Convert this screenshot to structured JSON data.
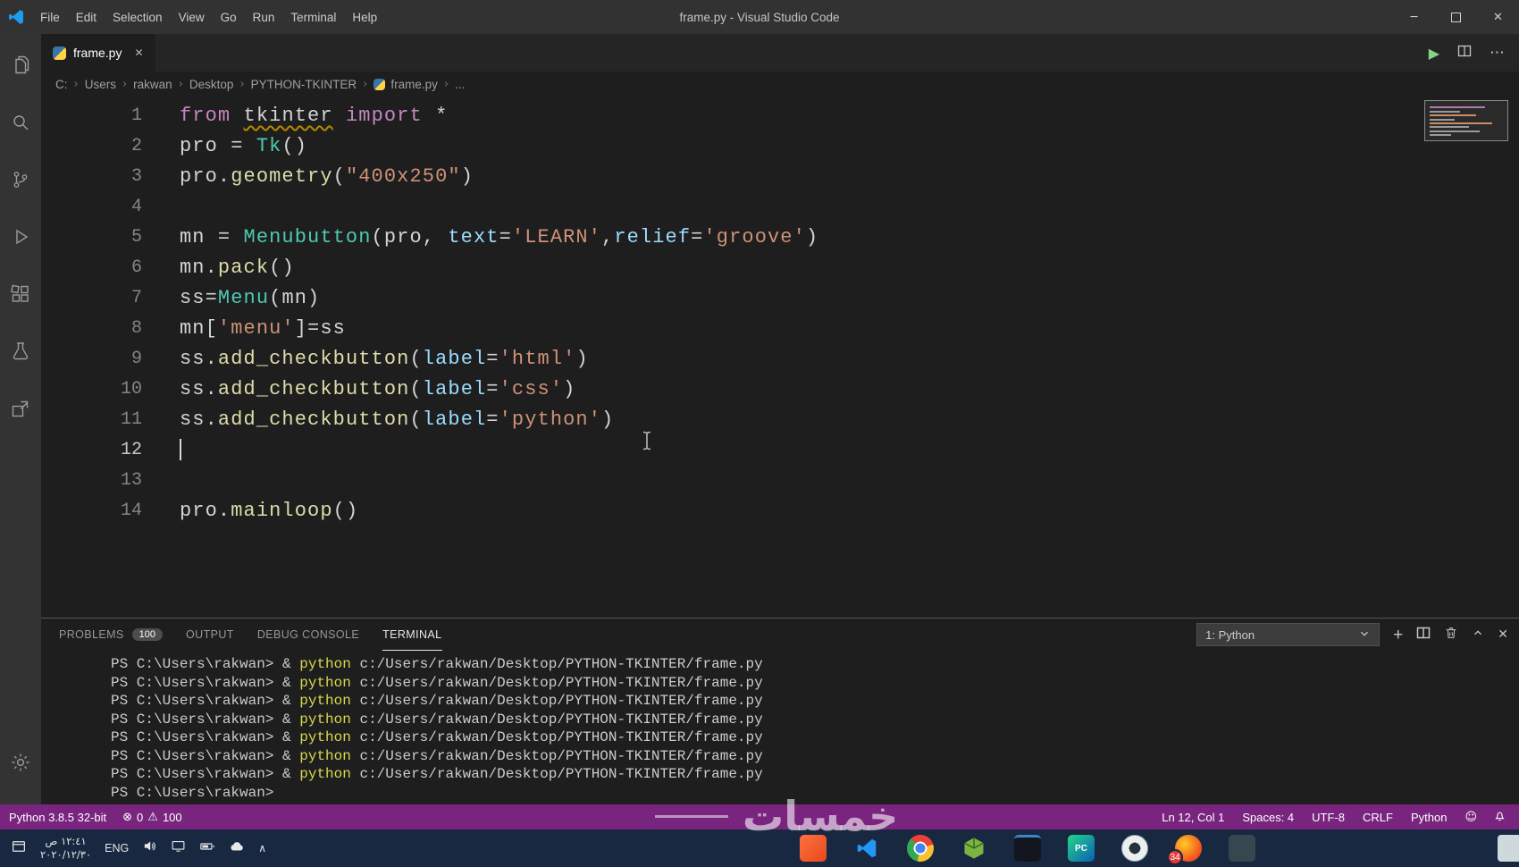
{
  "window": {
    "title": "frame.py - Visual Studio Code",
    "menu_items": [
      "File",
      "Edit",
      "Selection",
      "View",
      "Go",
      "Run",
      "Terminal",
      "Help"
    ]
  },
  "activity_bar": {
    "items": [
      "explorer",
      "search",
      "source-control",
      "run-debug",
      "extensions",
      "testing",
      "remote"
    ],
    "bottom_items": [
      "settings"
    ]
  },
  "tab_bar": {
    "tabs": [
      {
        "label": "frame.py"
      }
    ]
  },
  "breadcrumb": {
    "items": [
      {
        "label": "C:"
      },
      {
        "label": "Users"
      },
      {
        "label": "rakwan"
      },
      {
        "label": "Desktop"
      },
      {
        "label": "PYTHON-TKINTER"
      },
      {
        "label": "frame.py",
        "icon": "python"
      },
      {
        "label": "..."
      }
    ]
  },
  "editor": {
    "cursor": {
      "line": 12,
      "col": 1
    },
    "lines": [
      {
        "n": "1",
        "tokens": [
          [
            "from",
            "kw"
          ],
          [
            " ",
            "pl"
          ],
          [
            "tkinter",
            "err"
          ],
          [
            " ",
            "pl"
          ],
          [
            "import",
            "kw"
          ],
          [
            " *",
            "pl"
          ]
        ]
      },
      {
        "n": "2",
        "tokens": [
          [
            "pro = ",
            "pl"
          ],
          [
            "Tk",
            "cls"
          ],
          [
            "()",
            "pl"
          ]
        ]
      },
      {
        "n": "3",
        "tokens": [
          [
            "pro.",
            "pl"
          ],
          [
            "geometry",
            "fn"
          ],
          [
            "(",
            "pl"
          ],
          [
            "\"400x250\"",
            "str"
          ],
          [
            ")",
            "pl"
          ]
        ]
      },
      {
        "n": "4",
        "tokens": []
      },
      {
        "n": "5",
        "tokens": [
          [
            "mn = ",
            "pl"
          ],
          [
            "Menubutton",
            "cls"
          ],
          [
            "(pro, ",
            "pl"
          ],
          [
            "text",
            "param"
          ],
          [
            "=",
            "pl"
          ],
          [
            "'LEARN'",
            "str"
          ],
          [
            ",",
            "pl"
          ],
          [
            "relief",
            "param"
          ],
          [
            "=",
            "pl"
          ],
          [
            "'groove'",
            "str"
          ],
          [
            ")",
            "pl"
          ]
        ]
      },
      {
        "n": "6",
        "tokens": [
          [
            "mn.",
            "pl"
          ],
          [
            "pack",
            "fn"
          ],
          [
            "()",
            "pl"
          ]
        ]
      },
      {
        "n": "7",
        "tokens": [
          [
            "ss=",
            "pl"
          ],
          [
            "Menu",
            "cls"
          ],
          [
            "(mn)",
            "pl"
          ]
        ]
      },
      {
        "n": "8",
        "tokens": [
          [
            "mn[",
            "pl"
          ],
          [
            "'menu'",
            "str"
          ],
          [
            "]=ss",
            "pl"
          ]
        ]
      },
      {
        "n": "9",
        "tokens": [
          [
            "ss.",
            "pl"
          ],
          [
            "add_checkbutton",
            "fn"
          ],
          [
            "(",
            "pl"
          ],
          [
            "label",
            "param"
          ],
          [
            "=",
            "pl"
          ],
          [
            "'html'",
            "str"
          ],
          [
            ")",
            "pl"
          ]
        ]
      },
      {
        "n": "10",
        "tokens": [
          [
            "ss.",
            "pl"
          ],
          [
            "add_checkbutton",
            "fn"
          ],
          [
            "(",
            "pl"
          ],
          [
            "label",
            "param"
          ],
          [
            "=",
            "pl"
          ],
          [
            "'css'",
            "str"
          ],
          [
            ")",
            "pl"
          ]
        ]
      },
      {
        "n": "11",
        "tokens": [
          [
            "ss.",
            "pl"
          ],
          [
            "add_checkbutton",
            "fn"
          ],
          [
            "(",
            "pl"
          ],
          [
            "label",
            "param"
          ],
          [
            "=",
            "pl"
          ],
          [
            "'python'",
            "str"
          ],
          [
            ")",
            "pl"
          ]
        ]
      },
      {
        "n": "12",
        "tokens": [],
        "cursor": true
      },
      {
        "n": "13",
        "tokens": []
      },
      {
        "n": "14",
        "tokens": [
          [
            "pro.",
            "pl"
          ],
          [
            "mainloop",
            "fn"
          ],
          [
            "()",
            "pl"
          ]
        ]
      }
    ]
  },
  "panel": {
    "tabs": [
      {
        "label": "PROBLEMS",
        "badge": "100"
      },
      {
        "label": "OUTPUT"
      },
      {
        "label": "DEBUG CONSOLE"
      },
      {
        "label": "TERMINAL",
        "active": true
      }
    ],
    "shell_selector": "1: Python",
    "terminal_lines": [
      {
        "prompt": "PS C:\\Users\\rakwan>",
        "rest": " & ",
        "program": "python",
        "args": " c:/Users/rakwan/Desktop/PYTHON-TKINTER/frame.py"
      },
      {
        "prompt": "PS C:\\Users\\rakwan>",
        "rest": " & ",
        "program": "python",
        "args": " c:/Users/rakwan/Desktop/PYTHON-TKINTER/frame.py"
      },
      {
        "prompt": "PS C:\\Users\\rakwan>",
        "rest": " & ",
        "program": "python",
        "args": " c:/Users/rakwan/Desktop/PYTHON-TKINTER/frame.py"
      },
      {
        "prompt": "PS C:\\Users\\rakwan>",
        "rest": " & ",
        "program": "python",
        "args": " c:/Users/rakwan/Desktop/PYTHON-TKINTER/frame.py"
      },
      {
        "prompt": "PS C:\\Users\\rakwan>",
        "rest": " & ",
        "program": "python",
        "args": " c:/Users/rakwan/Desktop/PYTHON-TKINTER/frame.py"
      },
      {
        "prompt": "PS C:\\Users\\rakwan>",
        "rest": " & ",
        "program": "python",
        "args": " c:/Users/rakwan/Desktop/PYTHON-TKINTER/frame.py"
      },
      {
        "prompt": "PS C:\\Users\\rakwan>",
        "rest": " & ",
        "program": "python",
        "args": " c:/Users/rakwan/Desktop/PYTHON-TKINTER/frame.py"
      },
      {
        "prompt": "PS C:\\Users\\rakwan>"
      }
    ]
  },
  "status_bar": {
    "interpreter": "Python 3.8.5 32-bit",
    "errors": "0",
    "warnings": "100",
    "right_items": [
      "Ln 12, Col 1",
      "Spaces: 4",
      "UTF-8",
      "CRLF",
      "Python"
    ]
  },
  "taskbar": {
    "time": "١٢:٤١ ص",
    "date": "٢٠٢٠/١٢/٣٠",
    "language": "ENG",
    "apps": [
      {
        "name": "orange-app"
      },
      {
        "name": "vscode"
      },
      {
        "name": "chrome"
      },
      {
        "name": "green-cube"
      },
      {
        "name": "console"
      },
      {
        "name": "pycharm",
        "label": "PC"
      },
      {
        "name": "camera"
      },
      {
        "name": "browser",
        "badge": "34"
      },
      {
        "name": "dark-app"
      }
    ]
  },
  "watermark": {
    "text": "خمسات"
  },
  "colors": {
    "status_bar": "#792580",
    "taskbar": "#182840",
    "keyword": "#c586c0",
    "string": "#ce9178",
    "parameter": "#9cdcfe",
    "badge_red": "#e53935"
  }
}
